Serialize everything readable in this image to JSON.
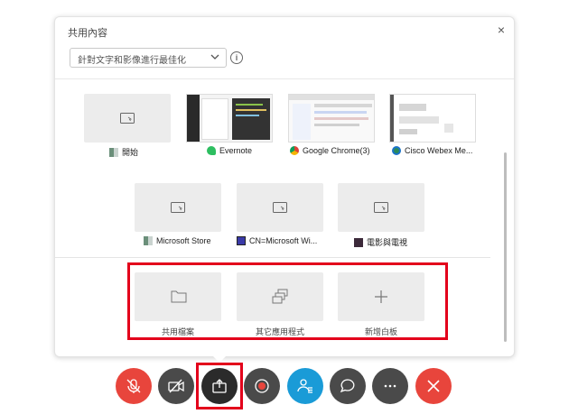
{
  "panel": {
    "title": "共用內容",
    "close_label": "×",
    "filter": {
      "selected": "針對文字和影像進行最佳化"
    },
    "info_label": "i"
  },
  "windows_row1": [
    {
      "label": "開始",
      "icon": "windows-app-icon"
    },
    {
      "label": "Evernote",
      "icon": "evernote-icon"
    },
    {
      "label": "Google Chrome(3)",
      "icon": "chrome-icon"
    },
    {
      "label": "Cisco Webex Me...",
      "icon": "webex-icon"
    }
  ],
  "windows_row2": [
    {
      "label": "Microsoft Store",
      "icon": "windows-app-icon"
    },
    {
      "label": "CN=Microsoft Wi...",
      "icon": "gear-square-icon"
    },
    {
      "label": "電影與電視",
      "icon": "movies-tv-icon"
    }
  ],
  "actions": [
    {
      "label": "共用檔案",
      "icon": "folder-icon"
    },
    {
      "label": "其它應用程式",
      "icon": "stacked-windows-icon"
    },
    {
      "label": "新增白板",
      "icon": "plus-icon"
    }
  ],
  "controls": [
    {
      "name": "mute",
      "icon": "microphone-muted-icon",
      "color": "#e8453c"
    },
    {
      "name": "video",
      "icon": "camera-off-icon",
      "color": "#4a4a4a"
    },
    {
      "name": "share",
      "icon": "share-icon",
      "color": "#2b2b2b"
    },
    {
      "name": "record",
      "icon": "record-icon",
      "color": "#4a4a4a"
    },
    {
      "name": "participants",
      "icon": "participants-icon",
      "color": "#1a9bd7"
    },
    {
      "name": "chat",
      "icon": "chat-icon",
      "color": "#4a4a4a"
    },
    {
      "name": "more",
      "icon": "more-icon",
      "color": "#4a4a4a"
    },
    {
      "name": "end",
      "icon": "close-icon",
      "color": "#e8453c"
    }
  ]
}
